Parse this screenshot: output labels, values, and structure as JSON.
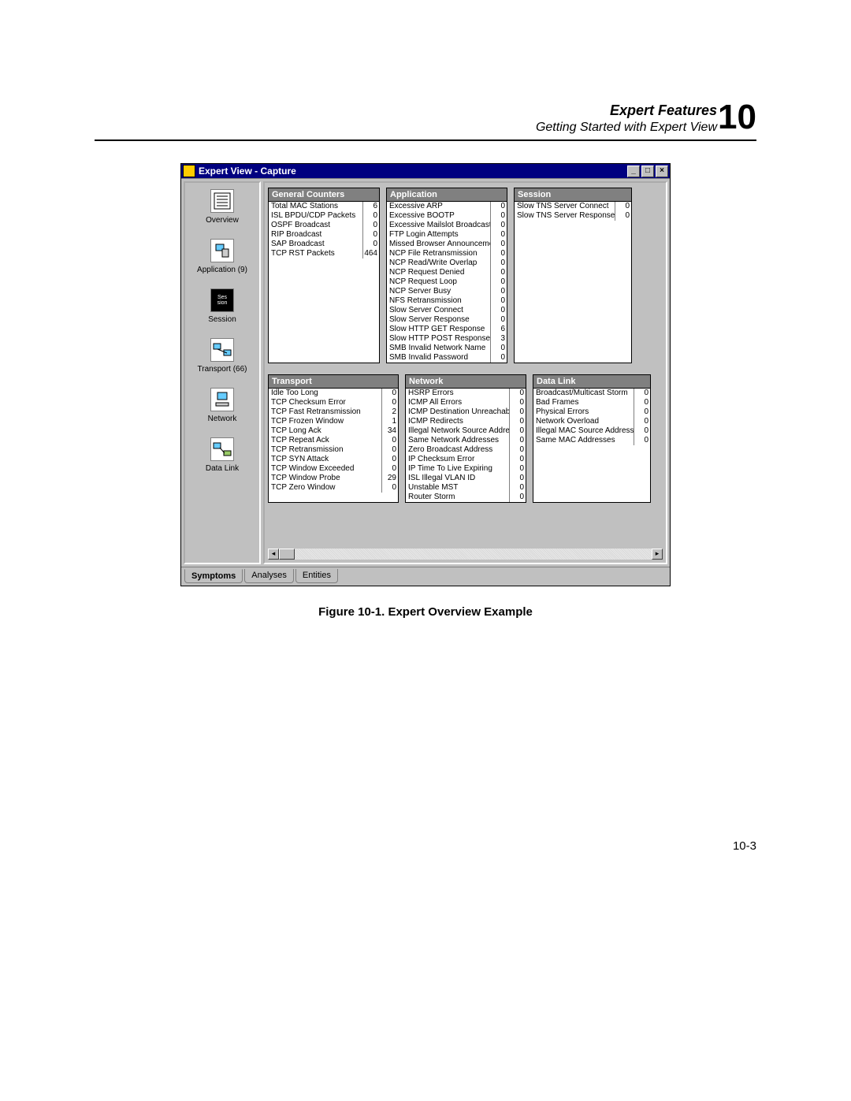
{
  "header": {
    "title_bold": "Expert Features",
    "subtitle": "Getting Started with Expert View",
    "chapter_number": "10"
  },
  "window": {
    "title": "Expert View - Capture"
  },
  "sidebar": {
    "items": [
      {
        "label": "Overview",
        "icon": "list-icon"
      },
      {
        "label": "Application (9)",
        "icon": "server-icon"
      },
      {
        "label": "Session",
        "icon": "session-icon"
      },
      {
        "label": "Transport (66)",
        "icon": "twohosts-icon"
      },
      {
        "label": "Network",
        "icon": "host-icon"
      },
      {
        "label": "Data Link",
        "icon": "nic-icon"
      }
    ]
  },
  "tabs": [
    {
      "label": "Symptoms",
      "active": true
    },
    {
      "label": "Analyses",
      "active": false
    },
    {
      "label": "Entities",
      "active": false
    }
  ],
  "panels": {
    "general_counters": {
      "title": "General Counters",
      "rows": [
        {
          "label": "Total MAC Stations",
          "value": "6"
        },
        {
          "label": "ISL BPDU/CDP Packets",
          "value": "0"
        },
        {
          "label": "OSPF Broadcast",
          "value": "0"
        },
        {
          "label": "RIP Broadcast",
          "value": "0"
        },
        {
          "label": "SAP Broadcast",
          "value": "0"
        },
        {
          "label": "TCP RST Packets",
          "value": "464"
        }
      ]
    },
    "application": {
      "title": "Application",
      "rows": [
        {
          "label": "Excessive ARP",
          "value": "0"
        },
        {
          "label": "Excessive BOOTP",
          "value": "0"
        },
        {
          "label": "Excessive Mailslot Broadcasts",
          "value": "0"
        },
        {
          "label": "FTP Login Attempts",
          "value": "0"
        },
        {
          "label": "Missed Browser Announcement",
          "value": "0"
        },
        {
          "label": "NCP File Retransmission",
          "value": "0"
        },
        {
          "label": "NCP Read/Write Overlap",
          "value": "0"
        },
        {
          "label": "NCP Request Denied",
          "value": "0"
        },
        {
          "label": "NCP Request Loop",
          "value": "0"
        },
        {
          "label": "NCP Server Busy",
          "value": "0"
        },
        {
          "label": "NFS Retransmission",
          "value": "0"
        },
        {
          "label": "Slow Server Connect",
          "value": "0"
        },
        {
          "label": "Slow Server Response",
          "value": "0"
        },
        {
          "label": "Slow HTTP GET Response",
          "value": "6"
        },
        {
          "label": "Slow HTTP POST Response",
          "value": "3"
        },
        {
          "label": "SMB Invalid Network Name",
          "value": "0"
        },
        {
          "label": "SMB Invalid Password",
          "value": "0"
        }
      ]
    },
    "session": {
      "title": "Session",
      "rows": [
        {
          "label": "Slow TNS Server Connect",
          "value": "0"
        },
        {
          "label": "Slow TNS Server Response",
          "value": "0"
        }
      ]
    },
    "transport": {
      "title": "Transport",
      "rows": [
        {
          "label": "Idle Too Long",
          "value": "0"
        },
        {
          "label": "TCP Checksum Error",
          "value": "0"
        },
        {
          "label": "TCP Fast Retransmission",
          "value": "2"
        },
        {
          "label": "TCP Frozen Window",
          "value": "1"
        },
        {
          "label": "TCP Long Ack",
          "value": "34"
        },
        {
          "label": "TCP Repeat Ack",
          "value": "0"
        },
        {
          "label": "TCP Retransmission",
          "value": "0"
        },
        {
          "label": "TCP SYN Attack",
          "value": "0"
        },
        {
          "label": "TCP Window Exceeded",
          "value": "0"
        },
        {
          "label": "TCP Window Probe",
          "value": "29"
        },
        {
          "label": "TCP Zero Window",
          "value": "0"
        }
      ]
    },
    "network": {
      "title": "Network",
      "rows": [
        {
          "label": "HSRP Errors",
          "value": "0"
        },
        {
          "label": "ICMP All Errors",
          "value": "0"
        },
        {
          "label": "ICMP Destination Unreachable",
          "value": "0"
        },
        {
          "label": "ICMP Redirects",
          "value": "0"
        },
        {
          "label": "Illegal Network Source Address",
          "value": "0"
        },
        {
          "label": "Same Network Addresses",
          "value": "0"
        },
        {
          "label": "Zero Broadcast Address",
          "value": "0"
        },
        {
          "label": "IP Checksum Error",
          "value": "0"
        },
        {
          "label": "IP Time To Live Expiring",
          "value": "0"
        },
        {
          "label": "ISL Illegal VLAN ID",
          "value": "0"
        },
        {
          "label": "Unstable MST",
          "value": "0"
        },
        {
          "label": "Router Storm",
          "value": "0"
        }
      ]
    },
    "datalink": {
      "title": "Data Link",
      "rows": [
        {
          "label": "Broadcast/Multicast Storm",
          "value": "0"
        },
        {
          "label": "Bad Frames",
          "value": "0"
        },
        {
          "label": "Physical Errors",
          "value": "0"
        },
        {
          "label": "Network Overload",
          "value": "0"
        },
        {
          "label": "Illegal MAC Source Address",
          "value": "0"
        },
        {
          "label": "Same MAC Addresses",
          "value": "0"
        }
      ]
    }
  },
  "caption": "Figure 10-1.  Expert Overview Example",
  "page_number": "10-3"
}
